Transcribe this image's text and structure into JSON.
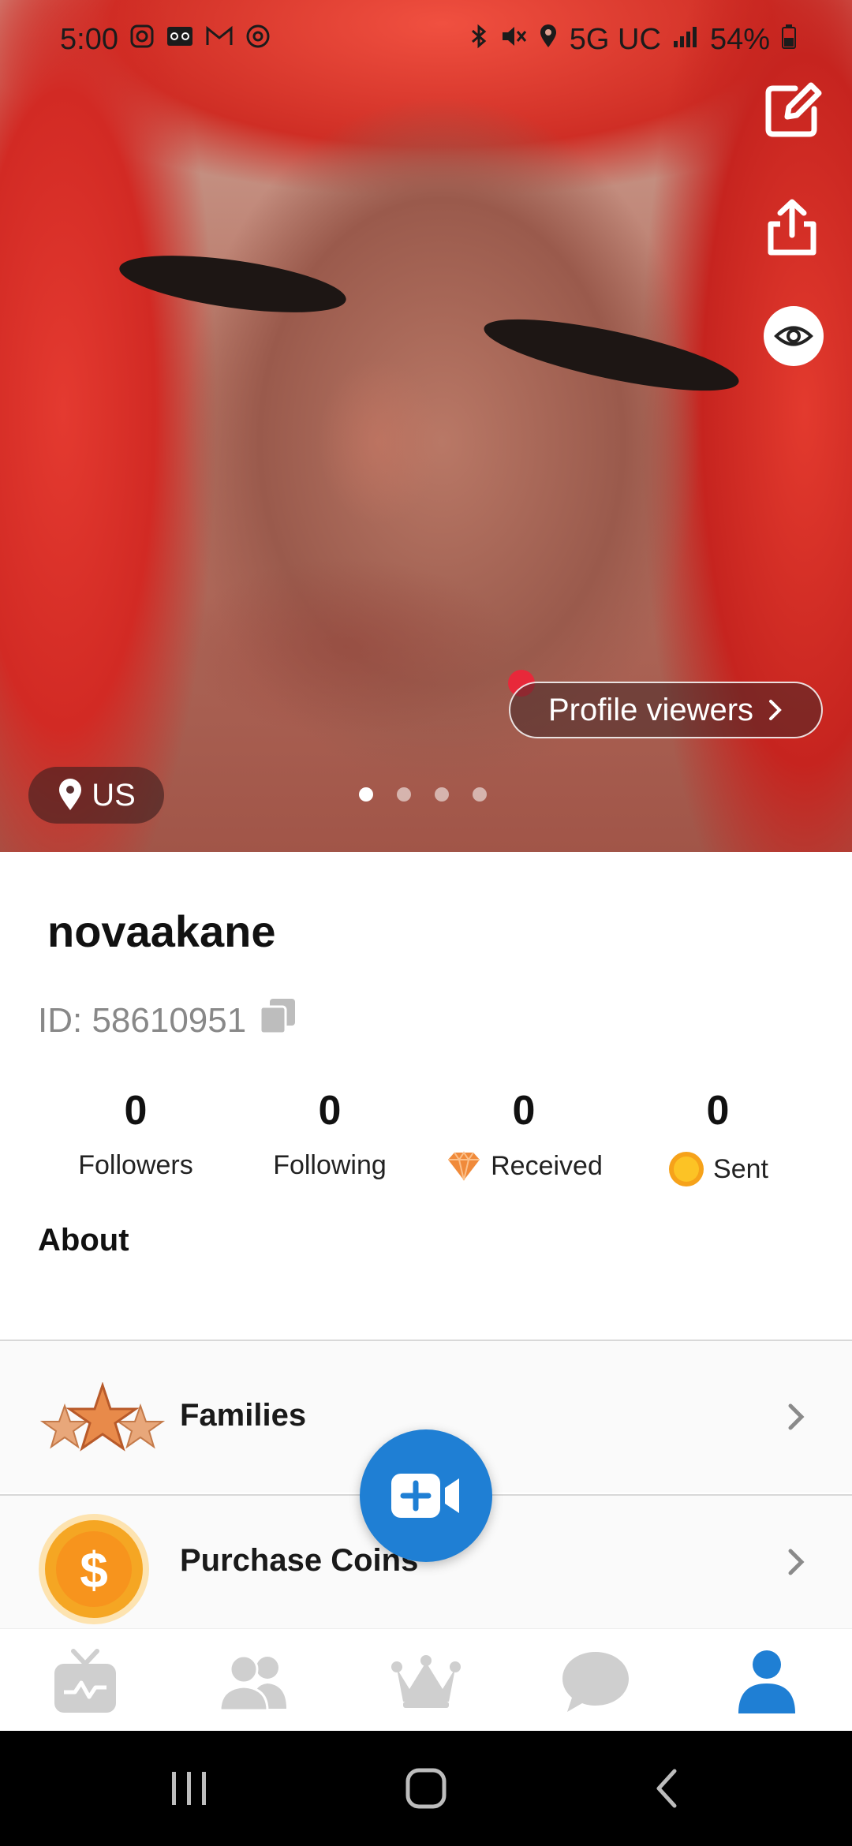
{
  "status_bar": {
    "time": "5:00",
    "network": "5G UC",
    "battery": "54%",
    "icons": [
      "instagram-icon",
      "voicemail-icon",
      "gmail-icon",
      "threads-icon",
      "bluetooth-icon",
      "mute-icon",
      "location-icon",
      "signal-icon",
      "battery-icon"
    ]
  },
  "hero": {
    "location": "US",
    "profile_viewers_label": "Profile viewers",
    "photo_count": 4,
    "active_photo": 1,
    "side_icons": [
      "edit-icon",
      "share-icon",
      "eye-icon"
    ]
  },
  "profile": {
    "username": "novaakane",
    "id_text": "ID: 58610951"
  },
  "stats": [
    {
      "value": "0",
      "label": "Followers",
      "icon": ""
    },
    {
      "value": "0",
      "label": "Following",
      "icon": ""
    },
    {
      "value": "0",
      "label": "Received",
      "icon": "diamond-icon"
    },
    {
      "value": "0",
      "label": "Sent",
      "icon": "coin-icon"
    }
  ],
  "about": {
    "label": "About"
  },
  "menu": {
    "families_label": "Families",
    "coins_label": "Purchase Coins"
  },
  "colors": {
    "accent": "#1f7fd4",
    "nav_inactive": "#d0d0d0",
    "coin": "#f6a21a",
    "diamond": "#f08a3a"
  },
  "bottom_nav": {
    "items": [
      "live-tv-icon",
      "friends-icon",
      "crown-icon",
      "chat-icon",
      "profile-icon"
    ],
    "active": "profile-icon"
  },
  "system_nav": [
    "recent-apps-icon",
    "home-icon",
    "back-icon"
  ]
}
